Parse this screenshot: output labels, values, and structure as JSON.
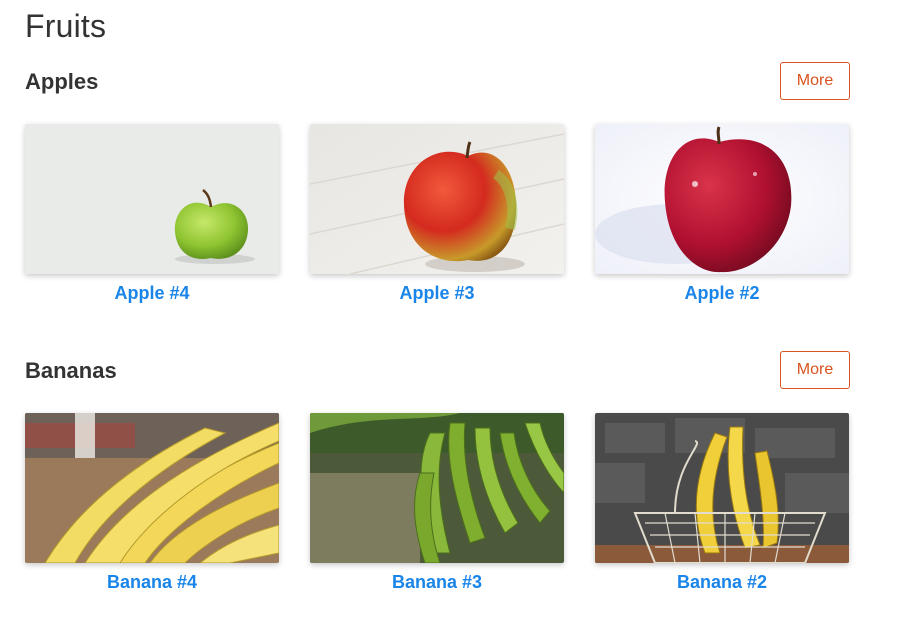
{
  "page": {
    "title": "Fruits"
  },
  "sections": [
    {
      "heading": "Apples",
      "more_label": "More",
      "items": [
        {
          "title": "Apple #4",
          "image": "green-apple-photo"
        },
        {
          "title": "Apple #3",
          "image": "red-yellow-apple-photo"
        },
        {
          "title": "Apple #2",
          "image": "red-apple-photo"
        }
      ]
    },
    {
      "heading": "Bananas",
      "more_label": "More",
      "items": [
        {
          "title": "Banana #4",
          "image": "banana-market-photo"
        },
        {
          "title": "Banana #3",
          "image": "banana-tree-photo"
        },
        {
          "title": "Banana #2",
          "image": "banana-basket-photo"
        }
      ]
    }
  ],
  "colors": {
    "accent": "#1a85e8",
    "button": "#d9531e",
    "text": "#333333"
  }
}
